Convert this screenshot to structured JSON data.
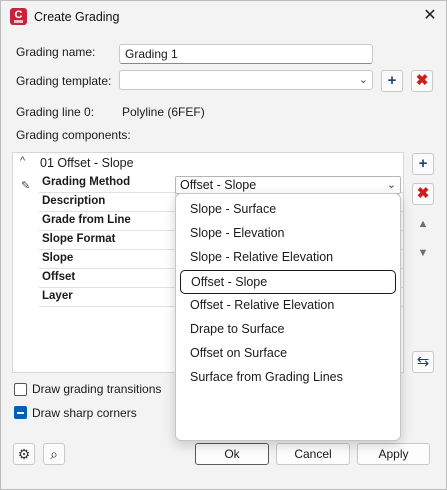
{
  "window": {
    "title": "Create Grading",
    "app_icon_letter": "C",
    "close_glyph": "✕"
  },
  "form": {
    "grading_name_label": "Grading name:",
    "grading_name_value": "Grading 1",
    "grading_template_label": "Grading template:",
    "grading_template_value": "",
    "grading_line_label": "Grading line 0:",
    "grading_line_value": "Polyline (6FEF)",
    "grading_components_label": "Grading components:"
  },
  "tree": {
    "component_title": "01 Offset - Slope",
    "properties": [
      {
        "name": "Grading Method",
        "value": "Offset - Slope"
      },
      {
        "name": "Description",
        "value": ""
      },
      {
        "name": "Grade from Line",
        "value": ""
      },
      {
        "name": "Slope Format",
        "value": ""
      },
      {
        "name": "Slope",
        "value": ""
      },
      {
        "name": "Offset",
        "value": ""
      },
      {
        "name": "Layer",
        "value": ""
      }
    ]
  },
  "dropdown": {
    "options": [
      "Slope - Surface",
      "Slope - Elevation",
      "Slope - Relative Elevation",
      "Offset - Slope",
      "Offset - Relative Elevation",
      "Drape to Surface",
      "Offset on Surface",
      "Surface from Grading Lines"
    ],
    "selected": "Offset - Slope"
  },
  "options": {
    "draw_transitions_label": "Draw grading transitions",
    "draw_transitions_checked": false,
    "draw_sharp_corners_label": "Draw sharp corners",
    "draw_sharp_corners_checked": true
  },
  "buttons": {
    "ok": "Ok",
    "cancel": "Cancel",
    "apply": "Apply"
  },
  "icons": {
    "add": "+",
    "delete": "✖",
    "move_up": "▲",
    "move_down": "▼",
    "swap": "⇆",
    "settings": "⚙",
    "zoom": "⌕",
    "pencil": "✎",
    "chevron_down": "⌄",
    "caret_up": "^"
  },
  "colors": {
    "accent": "#005fb8",
    "delete_red": "#d01c1c",
    "add_blue": "#1f3f78",
    "app_red": "#c8233b"
  }
}
